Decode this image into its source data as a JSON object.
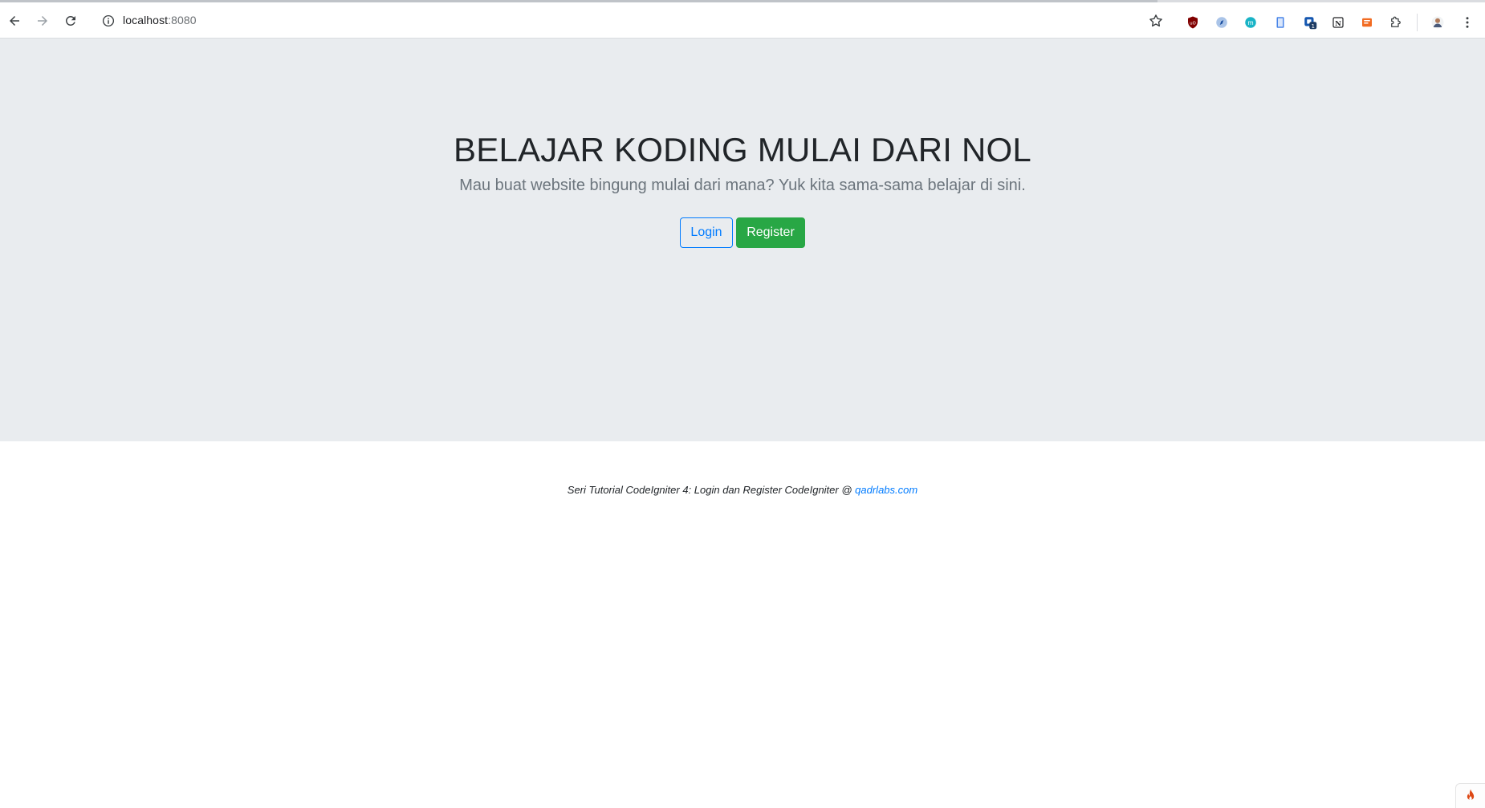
{
  "browser": {
    "url_host": "localhost",
    "url_port": ":8080",
    "icons": {
      "back": "arrow-left-icon",
      "forward": "arrow-right-icon",
      "reload": "reload-icon",
      "site_info": "info-icon",
      "bookmark": "star-icon",
      "extensions": [
        "ublock-icon",
        "compass-icon",
        "m-extension-icon",
        "clipboard-icon",
        "badge-extension-icon",
        "notion-icon",
        "reader-extension-icon",
        "puzzle-icon"
      ],
      "profile": "avatar-icon",
      "menu": "kebab-menu-icon"
    },
    "extension_badge_count": "1"
  },
  "hero": {
    "title": "BELAJAR KODING MULAI DARI NOL",
    "subtitle": "Mau buat website bingung mulai dari mana? Yuk kita sama-sama belajar di sini.",
    "login_label": "Login",
    "register_label": "Register"
  },
  "footer": {
    "text": "Seri Tutorial CodeIgniter 4: Login dan Register CodeIgniter @ ",
    "link_text": "qadrlabs.com"
  },
  "colors": {
    "jumbotron_bg": "#e9ecef",
    "primary": "#007bff",
    "success": "#28a745",
    "muted": "#6c757d"
  }
}
